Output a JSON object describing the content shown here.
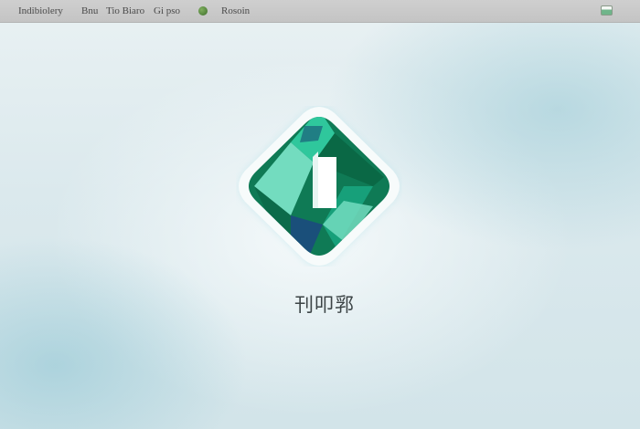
{
  "menubar": {
    "items": [
      {
        "label": "Indibiolery"
      },
      {
        "label": "Bnu"
      },
      {
        "label": "Tio Biaro"
      },
      {
        "label": "Gi pso"
      },
      {
        "label": "Rosoin"
      }
    ],
    "status_dot_color": "#4f8a3a"
  },
  "splash": {
    "logo_icon": "green-diamond-logo-icon",
    "caption": "刊叩郛"
  },
  "colors": {
    "logo_dark_green": "#0f7a55",
    "logo_teal": "#2fc79c",
    "logo_mint": "#73dcbf",
    "logo_navy": "#1a4f7a",
    "background": "#dbe9ed"
  }
}
